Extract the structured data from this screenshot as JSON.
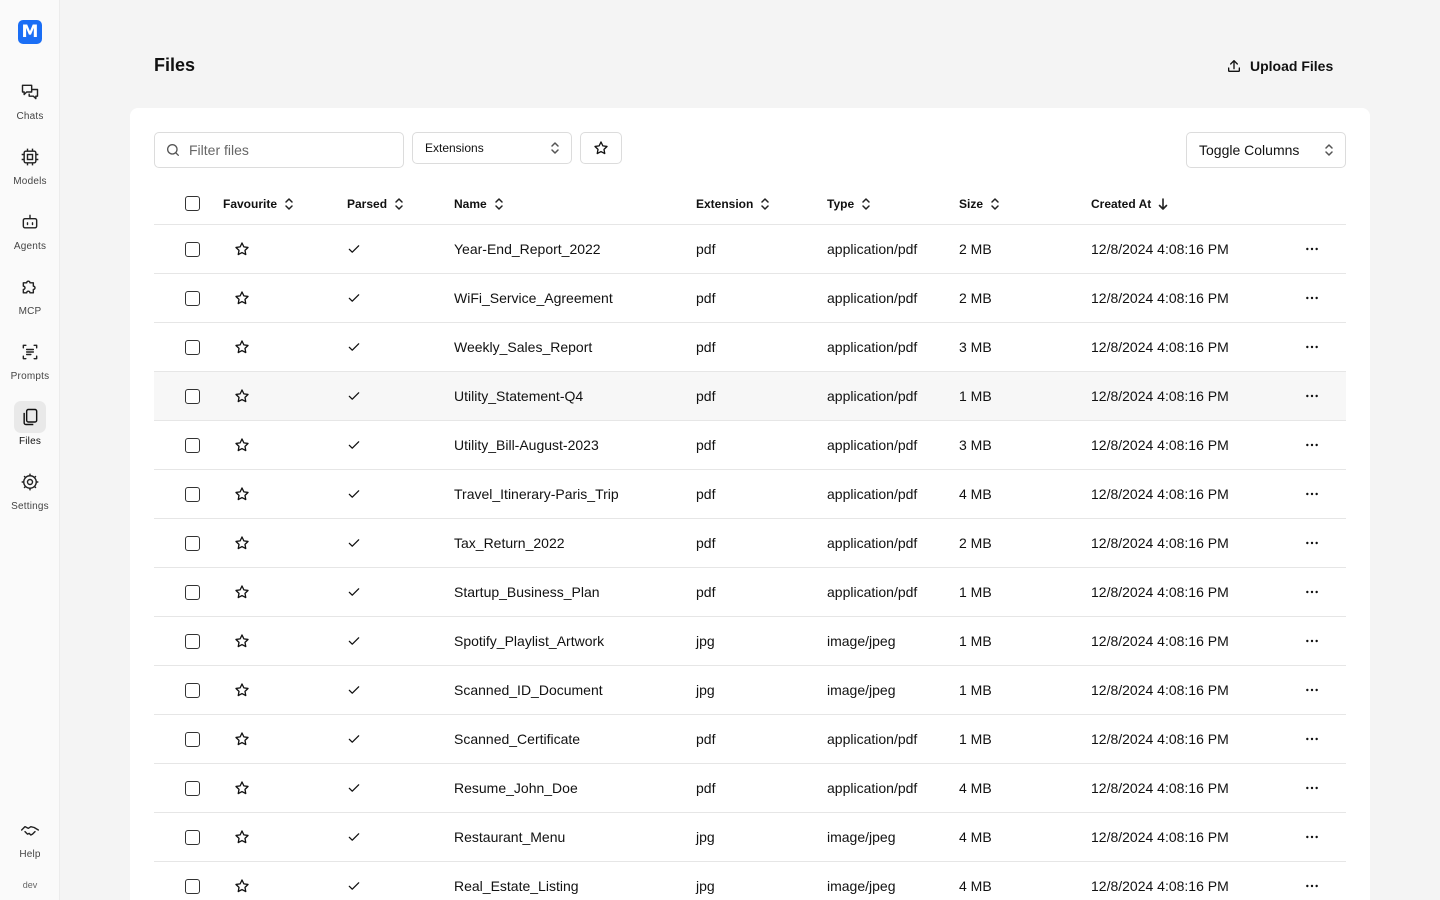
{
  "sidebar": {
    "logo": "M",
    "items": [
      {
        "label": "Chats",
        "icon": "chat-icon"
      },
      {
        "label": "Models",
        "icon": "chip-icon"
      },
      {
        "label": "Agents",
        "icon": "bot-icon"
      },
      {
        "label": "MCP",
        "icon": "puzzle-icon"
      },
      {
        "label": "Prompts",
        "icon": "prompts-icon"
      },
      {
        "label": "Files",
        "icon": "files-icon",
        "active": true
      },
      {
        "label": "Settings",
        "icon": "gear-icon"
      }
    ],
    "help": {
      "label": "Help",
      "icon": "handshake-icon"
    },
    "env": "dev"
  },
  "header": {
    "title": "Files",
    "upload_label": "Upload Files"
  },
  "toolbar": {
    "filter_placeholder": "Filter files",
    "extensions_label": "Extensions",
    "toggle_columns_label": "Toggle Columns"
  },
  "table": {
    "columns": [
      "Favourite",
      "Parsed",
      "Name",
      "Extension",
      "Type",
      "Size",
      "Created At"
    ],
    "rows": [
      {
        "name": "Year-End_Report_2022",
        "ext": "pdf",
        "type": "application/pdf",
        "size": "2 MB",
        "created": "12/8/2024 4:08:16 PM"
      },
      {
        "name": "WiFi_Service_Agreement",
        "ext": "pdf",
        "type": "application/pdf",
        "size": "2 MB",
        "created": "12/8/2024 4:08:16 PM"
      },
      {
        "name": "Weekly_Sales_Report",
        "ext": "pdf",
        "type": "application/pdf",
        "size": "3 MB",
        "created": "12/8/2024 4:08:16 PM"
      },
      {
        "name": "Utility_Statement-Q4",
        "ext": "pdf",
        "type": "application/pdf",
        "size": "1 MB",
        "created": "12/8/2024 4:08:16 PM"
      },
      {
        "name": "Utility_Bill-August-2023",
        "ext": "pdf",
        "type": "application/pdf",
        "size": "3 MB",
        "created": "12/8/2024 4:08:16 PM"
      },
      {
        "name": "Travel_Itinerary-Paris_Trip",
        "ext": "pdf",
        "type": "application/pdf",
        "size": "4 MB",
        "created": "12/8/2024 4:08:16 PM"
      },
      {
        "name": "Tax_Return_2022",
        "ext": "pdf",
        "type": "application/pdf",
        "size": "2 MB",
        "created": "12/8/2024 4:08:16 PM"
      },
      {
        "name": "Startup_Business_Plan",
        "ext": "pdf",
        "type": "application/pdf",
        "size": "1 MB",
        "created": "12/8/2024 4:08:16 PM"
      },
      {
        "name": "Spotify_Playlist_Artwork",
        "ext": "jpg",
        "type": "image/jpeg",
        "size": "1 MB",
        "created": "12/8/2024 4:08:16 PM"
      },
      {
        "name": "Scanned_ID_Document",
        "ext": "jpg",
        "type": "image/jpeg",
        "size": "1 MB",
        "created": "12/8/2024 4:08:16 PM"
      },
      {
        "name": "Scanned_Certificate",
        "ext": "pdf",
        "type": "application/pdf",
        "size": "1 MB",
        "created": "12/8/2024 4:08:16 PM"
      },
      {
        "name": "Resume_John_Doe",
        "ext": "pdf",
        "type": "application/pdf",
        "size": "4 MB",
        "created": "12/8/2024 4:08:16 PM"
      },
      {
        "name": "Restaurant_Menu",
        "ext": "jpg",
        "type": "image/jpeg",
        "size": "4 MB",
        "created": "12/8/2024 4:08:16 PM"
      },
      {
        "name": "Real_Estate_Listing",
        "ext": "jpg",
        "type": "image/jpeg",
        "size": "4 MB",
        "created": "12/8/2024 4:08:16 PM"
      }
    ]
  },
  "colors": {
    "accent": "#1a6ef5",
    "background": "#f4f4f4",
    "card": "#ffffff"
  }
}
